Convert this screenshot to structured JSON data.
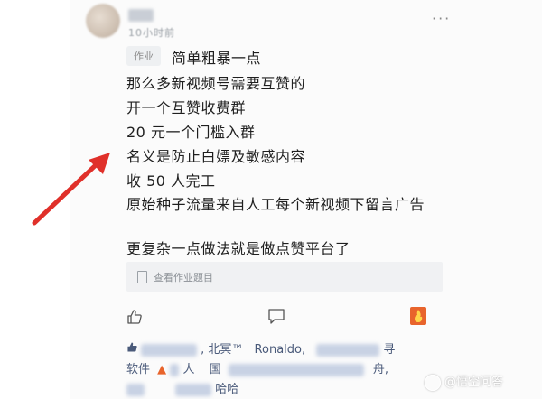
{
  "post": {
    "time": "10小时前",
    "more_label": "···",
    "tag": "作业",
    "title": "简单粗暴一点",
    "lines": [
      "那么多新视频号需要互赞的",
      "开一个互赞收费群",
      "20 元一个门槛入群",
      "名义是防止白嫖及敏感内容",
      "收 50 人完工",
      "原始种子流量来自人工每个新视频下留言广告",
      "更复杂一点做法就是做点赞平台了"
    ]
  },
  "assignment": {
    "label": "查看作业题目"
  },
  "likes": {
    "names": [
      ", 北冥™",
      "Ronaldo,",
      "寻"
    ],
    "row2": [
      "软件",
      "人",
      "国",
      "舟,"
    ],
    "row3": [
      "哈哈"
    ]
  },
  "watermark": {
    "text": "@悟空问答"
  },
  "colors": {
    "arrow": "#e0302a",
    "link": "#4a5a7a"
  },
  "icons": [
    "like-icon",
    "comment-icon",
    "flame-icon",
    "fire-emoji-icon"
  ]
}
